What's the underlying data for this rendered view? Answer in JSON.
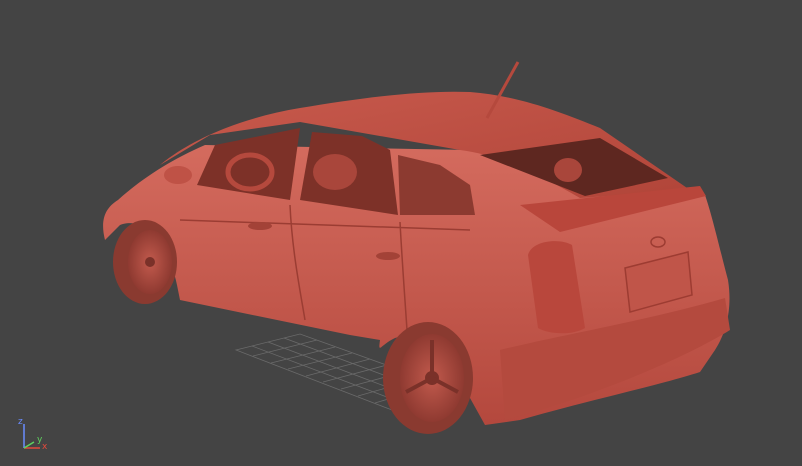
{
  "viewport": {
    "background_color": "#444444",
    "model_color": "#c85a4d"
  },
  "axis_gizmo": {
    "x_label": "x",
    "y_label": "y",
    "z_label": "z",
    "x_color": "#e34a3c",
    "y_color": "#5fd35f",
    "z_color": "#6a8cff"
  }
}
